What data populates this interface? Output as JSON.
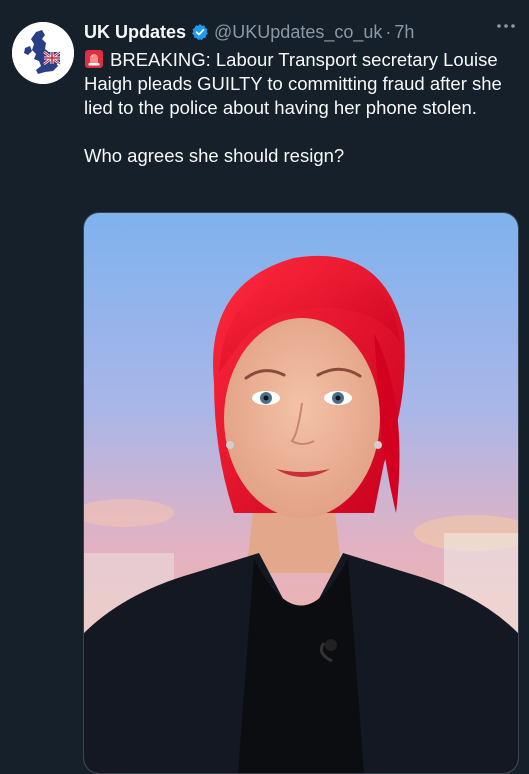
{
  "tweet": {
    "author_name": "UK Updates",
    "handle": "@UKUpdates_co_uk",
    "separator": "·",
    "time": "7h",
    "more_label": "···",
    "text_line1": "BREAKING: Labour Transport secretary Louise Haigh pleads GUILTY to committing fraud after she lied to the police about having her phone stolen.",
    "text_line2": "Who agrees she should resign?"
  },
  "colors": {
    "background": "#15202b",
    "verified": "#1d9bf0",
    "secondary_text": "#8b98a5"
  },
  "icons": {
    "avatar": "uk-map-flag-icon",
    "verified": "verified-badge-icon",
    "siren": "rotating-light-icon",
    "more": "more-icon"
  }
}
